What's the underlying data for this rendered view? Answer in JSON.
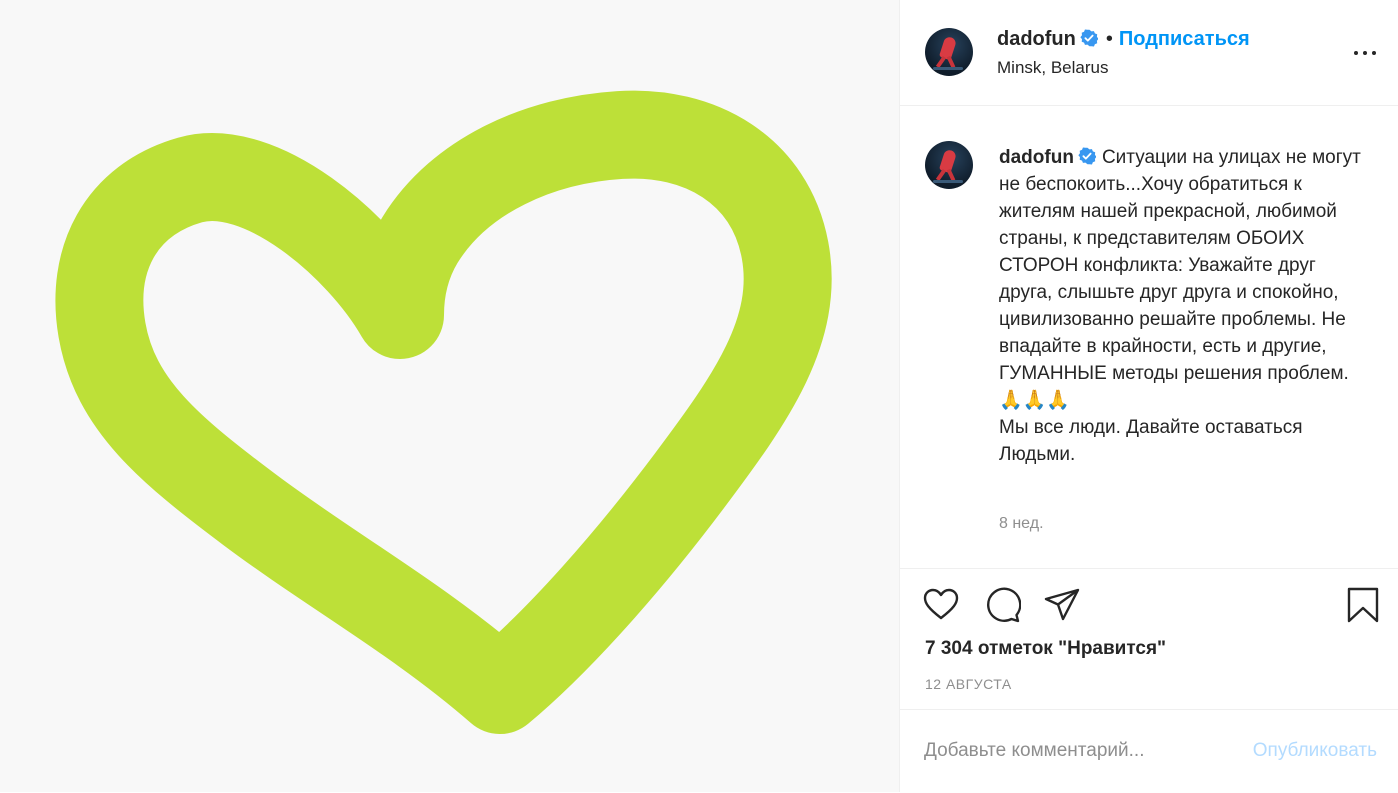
{
  "post": {
    "image": {
      "description_icon": "heart-outline-drawing",
      "stroke_color": "#bde038",
      "background_color": "#f8f8f8"
    },
    "header": {
      "username": "dadofun",
      "separator": "•",
      "follow_label": "Подписаться",
      "location": "Minsk, Belarus",
      "more_icon": "more-horizontal-icon"
    },
    "caption": {
      "username": "dadofun",
      "text": "Ситуации на улицах не могут не беспокоить...Хочу обратиться к жителям нашей прекрасной, любимой страны, к представителям ОБОИХ СТОРОН конфликта: Уважайте друг друга, слышьте друг друга и спокойно, цивилизованно решайте проблемы. Не впадайте в крайности, есть и другие, ГУМАННЫЕ методы решения проблем. 🙏🙏🙏\nМы все люди. Давайте оставаться Людьми.",
      "time_ago": "8 нед."
    },
    "actions": {
      "like_icon": "heart-icon",
      "comment_icon": "comment-icon",
      "share_icon": "paper-plane-icon",
      "save_icon": "bookmark-icon"
    },
    "likes_text": "7 304 отметок \"Нравится\"",
    "date": "12 АВГУСТА",
    "comment": {
      "placeholder": "Добавьте комментарий...",
      "publish_label": "Опубликовать"
    },
    "colors": {
      "accent": "#0095f6",
      "publish_disabled": "#b3dbff",
      "verified": "#3897f0"
    }
  }
}
